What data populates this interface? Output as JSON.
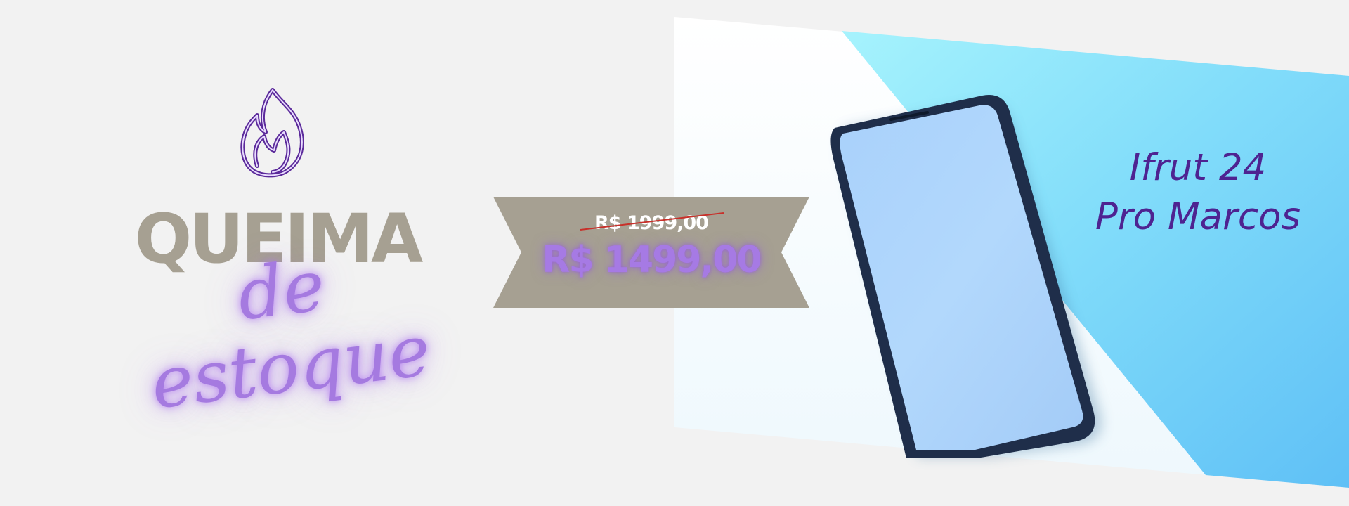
{
  "headline": {
    "main": "QUEIMA",
    "script": "de estoque"
  },
  "price": {
    "old": "R$ 1999,00",
    "new": "R$ 1499,00"
  },
  "product": {
    "line1": "Ifrut 24",
    "line2": "Pro Marcos"
  },
  "icons": {
    "flame": "flame-icon",
    "phone": "smartphone-photo"
  },
  "colors": {
    "background": "#f2f2f2",
    "headline_gray": "#a6a092",
    "accent_purple": "#a67ae4",
    "title_purple": "#4e2391",
    "ribbon": "#a6a092",
    "strike_red": "#c8302a",
    "photo_blue": "#7fdcfb"
  }
}
